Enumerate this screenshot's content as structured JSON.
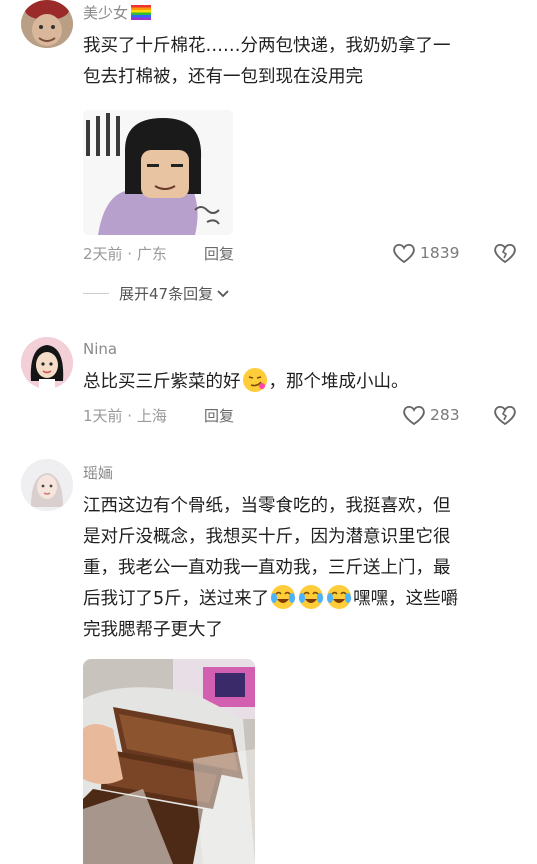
{
  "comments": [
    {
      "username": "美少女",
      "username_badge": "rainbow-flag",
      "lines": [
        "我买了十斤棉花……分两包快递，我奶奶拿了一",
        "包去打棉被，还有一包到现在没用完"
      ],
      "time_location": "2天前 · 广东",
      "reply_label": "回复",
      "like_count": "1839",
      "expand_label": "展开47条回复"
    },
    {
      "username": "Nina",
      "text_before_emoji": "总比买三斤紫菜的好",
      "emoji": "smirk-emoji",
      "text_after_emoji": "，那个堆成小山。",
      "time_location": "1天前 · 上海",
      "reply_label": "回复",
      "like_count": "283"
    },
    {
      "username": "瑶婳",
      "lines": [
        "江西这边有个骨纸，当零食吃的，我挺喜欢，但",
        "是对斤没概念，我想买十斤，因为潜意识里它很",
        "重，我老公一直劝我一直劝我，三斤送上门，最"
      ],
      "line4_before": "后我订了5斤，送过来了",
      "line4_emojis": [
        "crying-laughing-emoji",
        "crying-laughing-emoji",
        "crying-laughing-emoji"
      ],
      "line4_after": "嘿嘿，这些嚼",
      "line5": "完我腮帮子更大了"
    }
  ],
  "colors": {
    "text": "#1f1f1f",
    "meta": "#9a9a9a",
    "username": "#8a8a8a"
  }
}
